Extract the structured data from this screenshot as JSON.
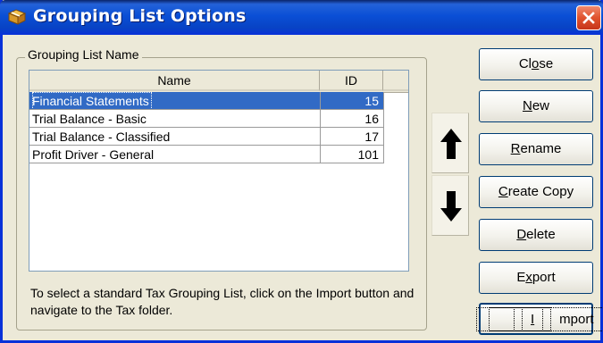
{
  "window": {
    "title": "Grouping List Options",
    "accent_color": "#0A4FD6",
    "close_color": "#E0522E",
    "title_icon": "grouping-list-app-icon",
    "close_icon": "close-icon"
  },
  "group": {
    "label": "Grouping List Name"
  },
  "list": {
    "columns": [
      "Name",
      "ID"
    ],
    "rows": [
      {
        "name": "Financial Statements",
        "id": "15",
        "selected": true
      },
      {
        "name": "Trial Balance - Basic",
        "id": "16",
        "selected": false
      },
      {
        "name": "Trial Balance - Classified",
        "id": "17",
        "selected": false
      },
      {
        "name": "Profit Driver  - General",
        "id": "101",
        "selected": false
      }
    ],
    "selection_color": "#316AC5"
  },
  "note": "To select a standard Tax Grouping List, click on the Import button and navigate to the Tax folder.",
  "move": {
    "up_icon": "arrow-up-icon",
    "down_icon": "arrow-down-icon"
  },
  "buttons": {
    "close": {
      "pre": "Cl",
      "key": "o",
      "post": "se"
    },
    "new": {
      "pre": "",
      "key": "N",
      "post": "ew"
    },
    "rename": {
      "pre": "",
      "key": "R",
      "post": "ename"
    },
    "create_copy": {
      "pre": "",
      "key": "C",
      "post": "reate Copy"
    },
    "delete": {
      "pre": "",
      "key": "D",
      "post": "elete"
    },
    "export": {
      "pre": "E",
      "key": "x",
      "post": "port"
    },
    "import": {
      "pre": "",
      "key": "I",
      "post": "mport"
    }
  }
}
